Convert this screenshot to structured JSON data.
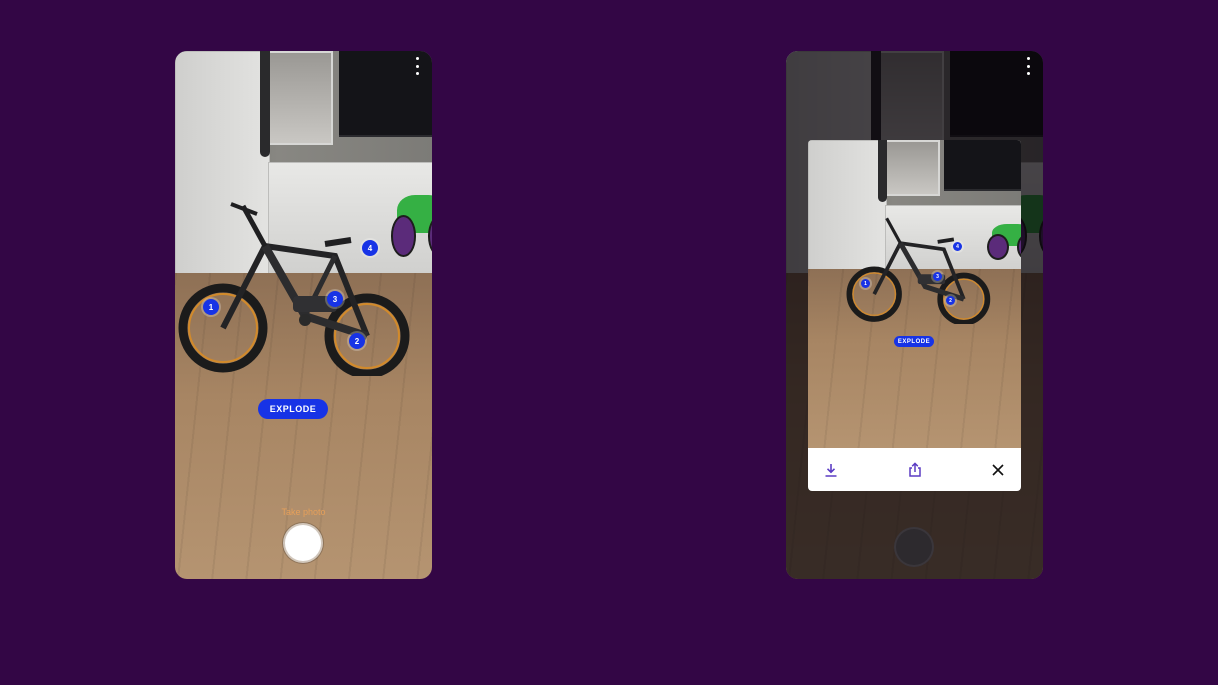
{
  "screens": {
    "left": {
      "explode_label": "EXPLODE",
      "take_photo_label": "Take photo",
      "hotspots": [
        "1",
        "2",
        "3",
        "4"
      ],
      "icons": {
        "menu": "more-vertical-icon",
        "shutter": "camera-shutter-icon"
      }
    },
    "right": {
      "preview": {
        "explode_label": "EXPLODE",
        "hotspots": [
          "1",
          "2",
          "3",
          "4"
        ]
      },
      "actions": {
        "download_icon": "download-icon",
        "share_icon": "share-icon",
        "close_icon": "close-icon"
      }
    }
  },
  "colors": {
    "background": "#330645",
    "accent": "#1733e6",
    "take_photo_text": "#e6a05a",
    "action_icon": "#5b3cc4"
  }
}
